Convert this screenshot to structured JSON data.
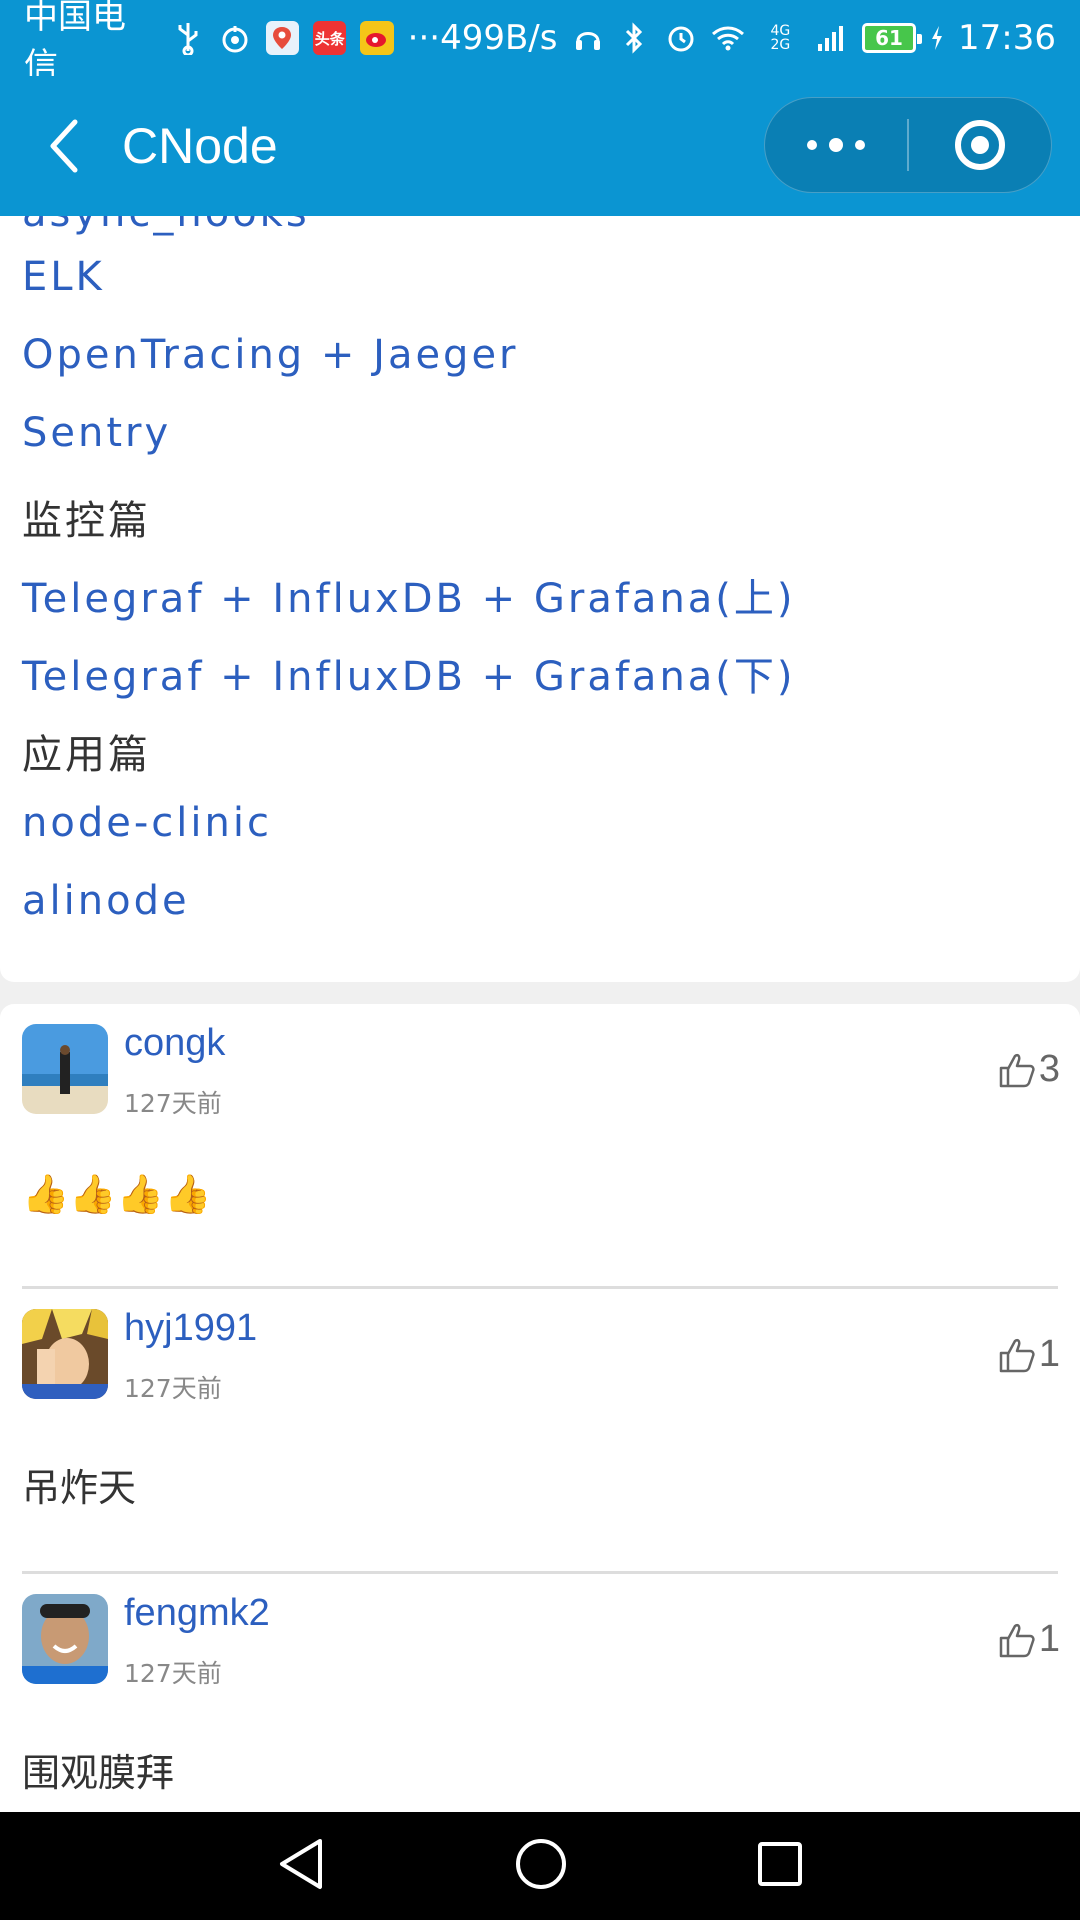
{
  "status_bar": {
    "carrier": "中国电信",
    "icons": [
      "usb-icon",
      "hotspot-icon",
      "map-app-icon",
      "toutiao-app-icon",
      "weibo-app-icon"
    ],
    "more": "···",
    "net_speed": "499B/s",
    "signal": "4G 2G",
    "battery": "61",
    "time": "17:36"
  },
  "navbar": {
    "title": "CNode"
  },
  "article": {
    "lines": [
      {
        "text": "async_hooks",
        "type": "link"
      },
      {
        "text": "ELK",
        "type": "link"
      },
      {
        "text": "OpenTracing + Jaeger",
        "type": "link"
      },
      {
        "text": "Sentry",
        "type": "link"
      },
      {
        "text": "监控篇",
        "type": "plain"
      },
      {
        "text": "Telegraf + InfluxDB + Grafana(上)",
        "type": "link"
      },
      {
        "text": "Telegraf + InfluxDB + Grafana(下)",
        "type": "link"
      },
      {
        "text": "应用篇",
        "type": "plain"
      },
      {
        "text": "node-clinic",
        "type": "link"
      },
      {
        "text": "alinode",
        "type": "link"
      }
    ]
  },
  "replies": [
    {
      "user": "congk",
      "time": "127天前",
      "likes": "3",
      "content": "👍👍👍👍"
    },
    {
      "user": "hyj1991",
      "time": "127天前",
      "likes": "1",
      "content": "吊炸天"
    },
    {
      "user": "fengmk2",
      "time": "127天前",
      "likes": "1",
      "content": "围观膜拜"
    }
  ],
  "colors": {
    "brand": "#0b95d2",
    "link": "#2c5fbf"
  }
}
